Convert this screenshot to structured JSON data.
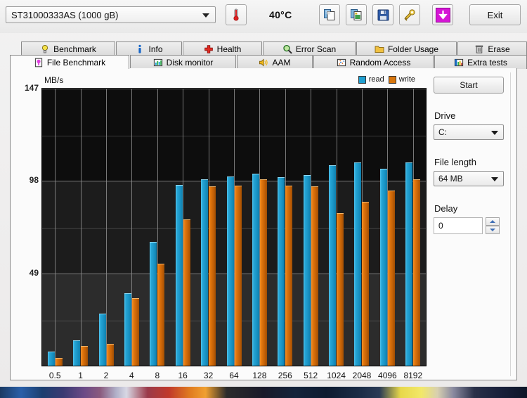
{
  "toolbar": {
    "drive_selected": "ST31000333AS (1000 gB)",
    "temperature": "40°C",
    "buttons": [
      {
        "name": "copy-button",
        "icon": "copy-icon"
      },
      {
        "name": "copy-image-button",
        "icon": "copy-image-icon"
      },
      {
        "name": "save-button",
        "icon": "floppy-save-icon"
      },
      {
        "name": "tools-button",
        "icon": "wrench-icon"
      },
      {
        "name": "download-button",
        "icon": "download-arrow-icon"
      }
    ],
    "exit_label": "Exit"
  },
  "tabs_row1": [
    {
      "label": "Benchmark",
      "icon": "bulb-icon",
      "active": false
    },
    {
      "label": "Info",
      "icon": "info-icon",
      "active": false
    },
    {
      "label": "Health",
      "icon": "cross-icon",
      "active": false
    },
    {
      "label": "Error Scan",
      "icon": "magnifier-icon",
      "active": false
    },
    {
      "label": "Folder Usage",
      "icon": "folder-icon",
      "active": false
    },
    {
      "label": "Erase",
      "icon": "trash-icon",
      "active": false
    }
  ],
  "tabs_row2": [
    {
      "label": "File Benchmark",
      "icon": "file-benchmark-icon",
      "active": true
    },
    {
      "label": "Disk monitor",
      "icon": "bars-icon",
      "active": false
    },
    {
      "label": "AAM",
      "icon": "speaker-icon",
      "active": false
    },
    {
      "label": "Random Access",
      "icon": "scatter-icon",
      "active": false
    },
    {
      "label": "Extra tests",
      "icon": "chart-icon",
      "active": false
    }
  ],
  "sidebar": {
    "start_label": "Start",
    "drive_label": "Drive",
    "drive_value": "C:",
    "file_length_label": "File length",
    "file_length_value": "64 MB",
    "delay_label": "Delay",
    "delay_value": "0"
  },
  "colors": {
    "read": "#1f9fd0",
    "write": "#d8760c",
    "plot_background": "#101010",
    "grid": "#8c8c8c"
  },
  "chart_data": {
    "type": "bar",
    "title": "",
    "ylabel": "MB/s",
    "xlabel": "",
    "unit": "MB/s",
    "ylim": [
      0,
      147
    ],
    "yticks": [
      147,
      98,
      49
    ],
    "ytick_labels": [
      "147",
      "98",
      "49"
    ],
    "grid": true,
    "legend": [
      "read",
      "write"
    ],
    "legend_position": "top-right",
    "categories": [
      "0.5",
      "1",
      "2",
      "4",
      "8",
      "16",
      "32",
      "64",
      "128",
      "256",
      "512",
      "1024",
      "2048",
      "4096",
      "8192"
    ],
    "series": [
      {
        "name": "read",
        "color": "#1f9fd0",
        "values": [
          7.5,
          13.5,
          27.5,
          38.5,
          65.5,
          96.0,
          99.0,
          100.5,
          102.0,
          100.0,
          101.0,
          106.5,
          108.0,
          104.5,
          108.0
        ]
      },
      {
        "name": "write",
        "color": "#d8760c",
        "values": [
          4.0,
          10.5,
          11.5,
          36.0,
          54.0,
          77.5,
          95.0,
          95.5,
          99.0,
          95.5,
          95.0,
          81.0,
          87.0,
          93.0,
          99.0
        ]
      }
    ]
  }
}
